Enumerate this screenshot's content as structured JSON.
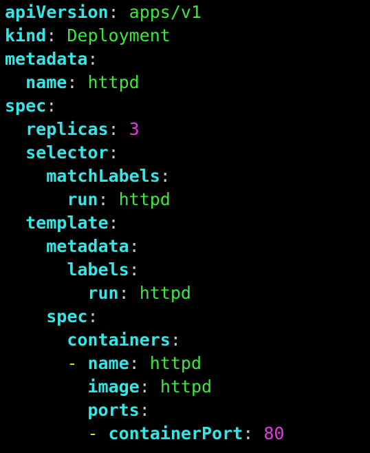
{
  "colors": {
    "background": "#000000",
    "key": "#35e6e6",
    "colon": "#c8c8c8",
    "string": "#3de83d",
    "number": "#e23be2",
    "dash": "#e0e020"
  },
  "lines": [
    {
      "key": "apiVersion",
      "value": "apps/v1"
    },
    {
      "key": "kind",
      "value": "Deployment"
    },
    {
      "key": "metadata"
    },
    {
      "key": "name",
      "value": "httpd"
    },
    {
      "key": "spec"
    },
    {
      "key": "replicas",
      "value": "3"
    },
    {
      "key": "selector"
    },
    {
      "key": "matchLabels"
    },
    {
      "key": "run",
      "value": "httpd"
    },
    {
      "key": "template"
    },
    {
      "key": "metadata"
    },
    {
      "key": "labels"
    },
    {
      "key": "run",
      "value": "httpd"
    },
    {
      "key": "spec"
    },
    {
      "key": "containers"
    },
    {
      "dash": "-",
      "key": "name",
      "value": "httpd"
    },
    {
      "key": "image",
      "value": "httpd"
    },
    {
      "key": "ports"
    },
    {
      "dash": "-",
      "key": "containerPort",
      "value": "80"
    }
  ],
  "colon_char": ":"
}
